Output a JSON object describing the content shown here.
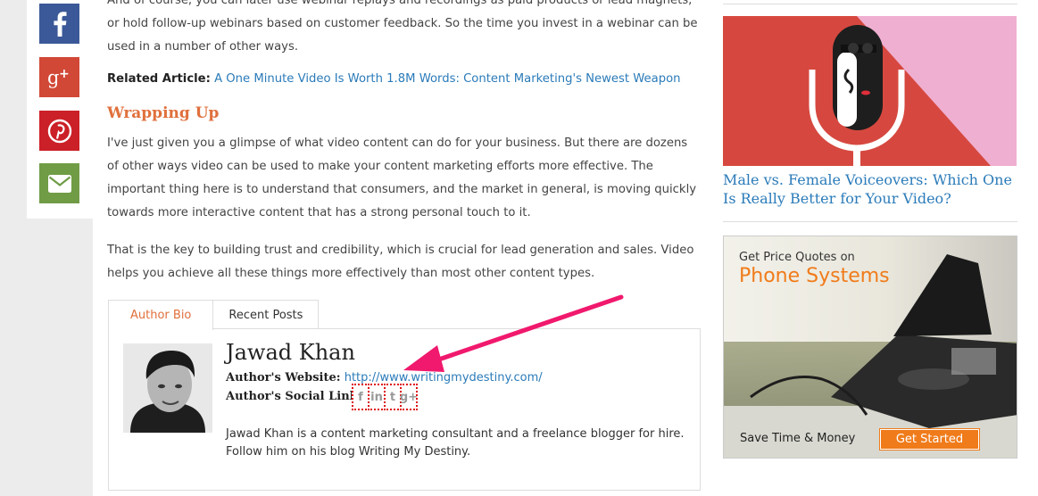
{
  "share": {
    "facebook": "f",
    "google_plus": "g+",
    "pinterest": "p",
    "email": "email"
  },
  "article": {
    "p1": "And of course, you can later use webinar replays and recordings as paid products or lead magnets, or hold follow-up webinars based on customer feedback. So the time you invest in a webinar can be used in a number of other ways.",
    "related_label": "Related Article:",
    "related_link": "A One Minute Video Is Worth 1.8M Words: Content Marketing's Newest Weapon",
    "section_heading": "Wrapping Up",
    "p2": "I've just given you a glimpse of what video content can do for your business. But there are dozens of other ways video can be used to make your content marketing efforts more effective. The important thing here is to understand that consumers, and the market in general, is moving quickly towards more interactive content that has a strong personal touch to it.",
    "p3": "That is the key to building trust and credibility, which is crucial for lead generation and sales. Video helps you achieve all these things more effectively than most other content types."
  },
  "tabs": {
    "author_bio": "Author Bio",
    "recent_posts": "Recent Posts"
  },
  "author": {
    "name": "Jawad Khan",
    "website_label": "Author's Website:",
    "website_url": "http://www.writingmydestiny.com/",
    "social_label": "Author's Social Links:",
    "social_icons": [
      "f",
      "in",
      "t",
      "g+"
    ],
    "bio": "Jawad Khan is a content marketing consultant and a freelance blogger for hire. Follow him on his blog Writing My Destiny."
  },
  "sidebar": {
    "article_title": "Male vs. Female Voiceovers: Which One Is Really Better for Your Video?",
    "ad_small": "Get Price Quotes on",
    "ad_big": "Phone Systems",
    "ad_footer": "Save Time & Money",
    "ad_button": "Get Started"
  },
  "colors": {
    "accent": "#e0703c",
    "link": "#2b7bb9",
    "ad_orange": "#f07b1a",
    "arrow": "#f0196d"
  }
}
